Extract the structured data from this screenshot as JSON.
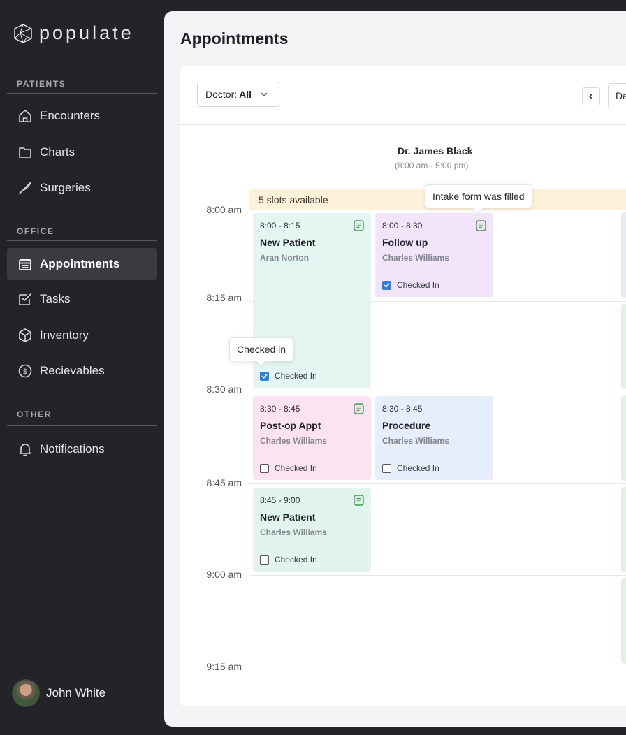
{
  "app": {
    "name": "populate"
  },
  "sidebar": {
    "sections": [
      {
        "label": "PATIENTS",
        "items": [
          {
            "label": "Encounters",
            "icon": "home-icon"
          },
          {
            "label": "Charts",
            "icon": "folder-icon"
          },
          {
            "label": "Surgeries",
            "icon": "scalpel-icon"
          }
        ]
      },
      {
        "label": "OFFICE",
        "items": [
          {
            "label": "Appointments",
            "icon": "calendar-icon",
            "active": true
          },
          {
            "label": "Tasks",
            "icon": "checkbox-icon"
          },
          {
            "label": "Inventory",
            "icon": "box-icon"
          },
          {
            "label": "Recievables",
            "icon": "dollar-icon"
          }
        ]
      },
      {
        "label": "OTHER",
        "items": [
          {
            "label": "Notifications",
            "icon": "bell-icon"
          }
        ]
      }
    ],
    "user": {
      "name": "John White"
    }
  },
  "main": {
    "title": "Appointments",
    "toolbar": {
      "doctor_label": "Doctor:",
      "doctor_value": "All",
      "view_label": "Da"
    },
    "doctor": {
      "name": "Dr. James Black",
      "hours": "(8:00 am - 5:00 pm)"
    },
    "slots_banner": "5 slots available",
    "time_labels": [
      "8:00 am",
      "8:15 am",
      "8:30 am",
      "8:45 am",
      "9:00 am",
      "9:15 am"
    ],
    "appointments": [
      {
        "time": "8:00 - 8:15",
        "title": "New Patient",
        "patient": "Aran Norton",
        "check_label": "Checked In",
        "checked": true,
        "color": "#e3f6f2"
      },
      {
        "time": "8:00 - 8:30",
        "title": "Follow up",
        "patient": "Charles Williams",
        "check_label": "Checked In",
        "checked": true,
        "color": "#f1e4fb"
      },
      {
        "time": "8:30 - 8:45",
        "title": "Post-op Appt",
        "patient": "Charles Williams",
        "check_label": "Checked In",
        "checked": false,
        "color": "#fce3f2"
      },
      {
        "time": "8:30 - 8:45",
        "title": "Procedure",
        "patient": "Charles Williams",
        "check_label": "Checked In",
        "checked": false,
        "color": "#e6edfb"
      },
      {
        "time": "8:45 - 9:00",
        "title": "New Patient",
        "patient": "Charles Williams",
        "check_label": "Checked In",
        "checked": false,
        "color": "#e1f5ee"
      }
    ],
    "tooltips": {
      "intake": "Intake form was filled",
      "checked": "Checked in"
    },
    "colors": {
      "sidebar_bg": "#232427",
      "form_icon": "#3c9a4f",
      "checkbox_on": "#2f7fe0",
      "banner": "#fdf2d9"
    }
  }
}
